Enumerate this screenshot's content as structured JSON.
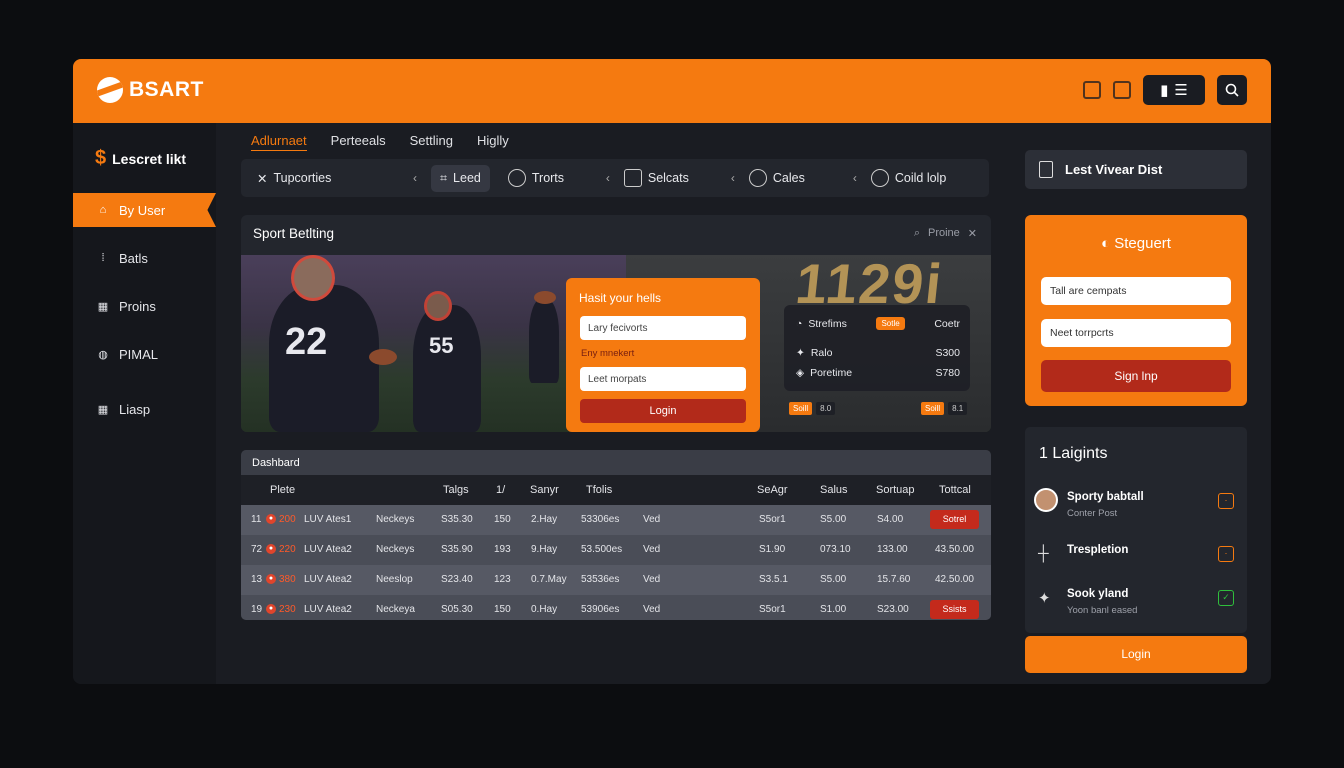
{
  "brand": {
    "name": "BSART"
  },
  "sidebar": {
    "title": "Lescret likt",
    "items": [
      {
        "label": "By User",
        "icon": "home-icon"
      },
      {
        "label": "Batls",
        "icon": "dots-icon"
      },
      {
        "label": "Proins",
        "icon": "grid-icon"
      },
      {
        "label": "PIMAL",
        "icon": "ball-icon"
      },
      {
        "label": "Liasp",
        "icon": "table-icon"
      }
    ]
  },
  "tabs": [
    "Adlurnaet",
    "Perteeals",
    "Settling",
    "Higlly"
  ],
  "filters": [
    {
      "label": "Tupcorties",
      "icon": "close-icon"
    },
    {
      "label": "Leed",
      "icon": "tag-icon"
    },
    {
      "label": "Trorts",
      "icon": "ball-icon"
    },
    {
      "label": "Selcats",
      "icon": "shirt-icon"
    },
    {
      "label": "Cales",
      "icon": "helmet-icon"
    },
    {
      "label": "Coild lolp",
      "icon": "helmet-icon"
    }
  ],
  "panel": {
    "title": "Sport Betlting",
    "tool_label": "Proine",
    "big_number": "1129i",
    "player_numbers": [
      "22",
      "55"
    ]
  },
  "hero_form": {
    "title": "Hasit your hells",
    "field1": "Lary fecivorts",
    "note": "Eny mnekert",
    "field2": "Leet morpats",
    "button": "Login"
  },
  "odds_card": {
    "rows": [
      {
        "label": "Strefims",
        "badge": "Sotle",
        "value": "Coetr"
      },
      {
        "label": "Ralo",
        "value": "S300"
      },
      {
        "label": "Poretime",
        "value": "S780"
      }
    ],
    "tags": [
      {
        "o": "Soill",
        "d": "8.0"
      },
      {
        "o": "Soill",
        "d": "8.1"
      }
    ]
  },
  "table": {
    "title": "Dashbard",
    "headers": [
      "Plete",
      "Talgs",
      "1/",
      "Sanyr",
      "Tfolis",
      "SeAgr",
      "Salus",
      "Sortuap",
      "Tottcal"
    ],
    "rows": [
      {
        "num": "11",
        "code": "200",
        "name": "LUV Ates1",
        "type": "Neckeys",
        "talgs": "S35.30",
        "n": "150",
        "date": "2.Hay",
        "total": "53306es",
        "st": "Ved",
        "seagr": "S5or1",
        "salus": "S5.00",
        "sortuap": "S4.00",
        "action": "Sotrel"
      },
      {
        "num": "72",
        "code": "220",
        "name": "LUV Atea2",
        "type": "Neckeys",
        "talgs": "S35.90",
        "n": "193",
        "date": "9.Hay",
        "total": "53.500es",
        "st": "Ved",
        "seagr": "S1.90",
        "salus": "073.10",
        "sortuap": "133.00",
        "action": "43.50.00"
      },
      {
        "num": "13",
        "code": "380",
        "name": "LUV Atea2",
        "type": "Neeslop",
        "talgs": "S23.40",
        "n": "123",
        "date": "0.7.May",
        "total": "53536es",
        "st": "Ved",
        "seagr": "S3.5.1",
        "salus": "S5.00",
        "sortuap": "15.7.60",
        "action": "42.50.00"
      },
      {
        "num": "19",
        "code": "230",
        "name": "LUV Atea2",
        "type": "Neckeya",
        "talgs": "S05.30",
        "n": "150",
        "date": "0.Hay",
        "total": "53906es",
        "st": "Ved",
        "seagr": "S5or1",
        "salus": "S1.00",
        "sortuap": "S23.00",
        "action": "Ssists"
      }
    ]
  },
  "right": {
    "header": "Lest Vivear Dist",
    "signup": {
      "brand": "Steguert",
      "field1": "Tall are cempats",
      "field2": "Neet torrpcrts",
      "button": "Sign lnp"
    },
    "logins": {
      "title": "1 Laigints",
      "items": [
        {
          "name": "Sporty babtall",
          "sub": "Conter Post",
          "icon": "avatar"
        },
        {
          "name": "Trespletion",
          "sub": "",
          "icon": "crosshair-icon"
        },
        {
          "name": "Sook yland",
          "sub": "Yoon banl eased",
          "icon": "twitter-icon"
        }
      ]
    },
    "login_button": "Login"
  },
  "colors": {
    "accent": "#f57a10",
    "danger": "#c42a1c",
    "panel": "#23262d"
  }
}
